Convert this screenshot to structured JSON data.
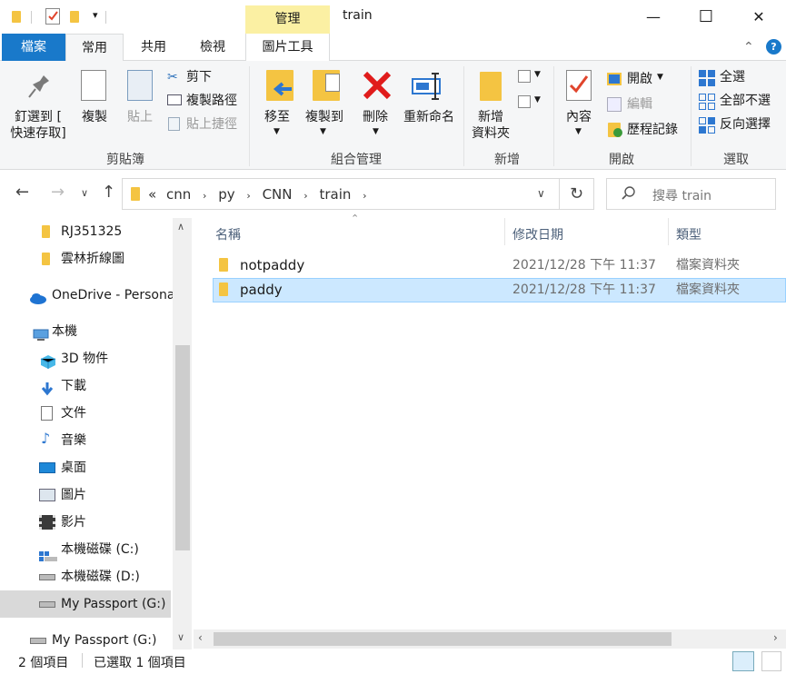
{
  "window": {
    "title": "train",
    "contextual_tab": "管理",
    "minimize": "—",
    "maximize": "☐",
    "close": "✕"
  },
  "tabs": {
    "file": "檔案",
    "home": "常用",
    "share": "共用",
    "view": "檢視",
    "picture_tools": "圖片工具"
  },
  "ribbon": {
    "clipboard": {
      "label": "剪貼簿",
      "pin": [
        "釘選到 [",
        "快速存取]"
      ],
      "copy": "複製",
      "paste": "貼上",
      "cut": "剪下",
      "copy_path": "複製路徑",
      "paste_shortcut": "貼上捷徑"
    },
    "organize": {
      "label": "組合管理",
      "move_to": "移至",
      "copy_to": "複製到",
      "delete": "刪除",
      "rename": "重新命名"
    },
    "new": {
      "label": "新增",
      "new_folder": [
        "新增",
        "資料夾"
      ]
    },
    "open": {
      "label": "開啟",
      "properties": "內容",
      "open": "開啟",
      "edit": "編輯",
      "history": "歷程記錄"
    },
    "select": {
      "label": "選取",
      "select_all": "全選",
      "select_none": "全部不選",
      "invert": "反向選擇"
    }
  },
  "address": {
    "crumbs": [
      "«",
      "cnn",
      "py",
      "CNN",
      "train"
    ],
    "search_placeholder": "搜尋 train"
  },
  "sidebar": {
    "items": [
      {
        "label": "RJ351325",
        "icon": "folder-icon"
      },
      {
        "label": "雲林折線圖",
        "icon": "folder-icon"
      },
      {
        "label": "OneDrive - Persona",
        "icon": "onedrive-icon"
      },
      {
        "label": "本機",
        "icon": "this-pc-icon"
      },
      {
        "label": "3D 物件",
        "icon": "3d-objects-icon"
      },
      {
        "label": "下載",
        "icon": "download-icon"
      },
      {
        "label": "文件",
        "icon": "documents-icon"
      },
      {
        "label": "音樂",
        "icon": "music-icon"
      },
      {
        "label": "桌面",
        "icon": "desktop-icon"
      },
      {
        "label": "圖片",
        "icon": "pictures-icon"
      },
      {
        "label": "影片",
        "icon": "videos-icon"
      },
      {
        "label": "本機磁碟 (C:)",
        "icon": "drive-icon"
      },
      {
        "label": "本機磁碟 (D:)",
        "icon": "drive-icon"
      },
      {
        "label": "My Passport (G:)",
        "icon": "drive-icon"
      },
      {
        "label": "My Passport (G:)",
        "icon": "drive-icon"
      }
    ]
  },
  "columns": {
    "name": "名稱",
    "modified": "修改日期",
    "type": "類型"
  },
  "files": [
    {
      "name": "notpaddy",
      "modified": "2021/12/28 下午 11:37",
      "type": "檔案資料夾"
    },
    {
      "name": "paddy",
      "modified": "2021/12/28 下午 11:37",
      "type": "檔案資料夾"
    }
  ],
  "status": {
    "count": "2 個項目",
    "selected": "已選取 1 個項目"
  },
  "colors": {
    "accent": "#1979ca",
    "selection": "#cce8ff",
    "folder": "#f4c442"
  }
}
